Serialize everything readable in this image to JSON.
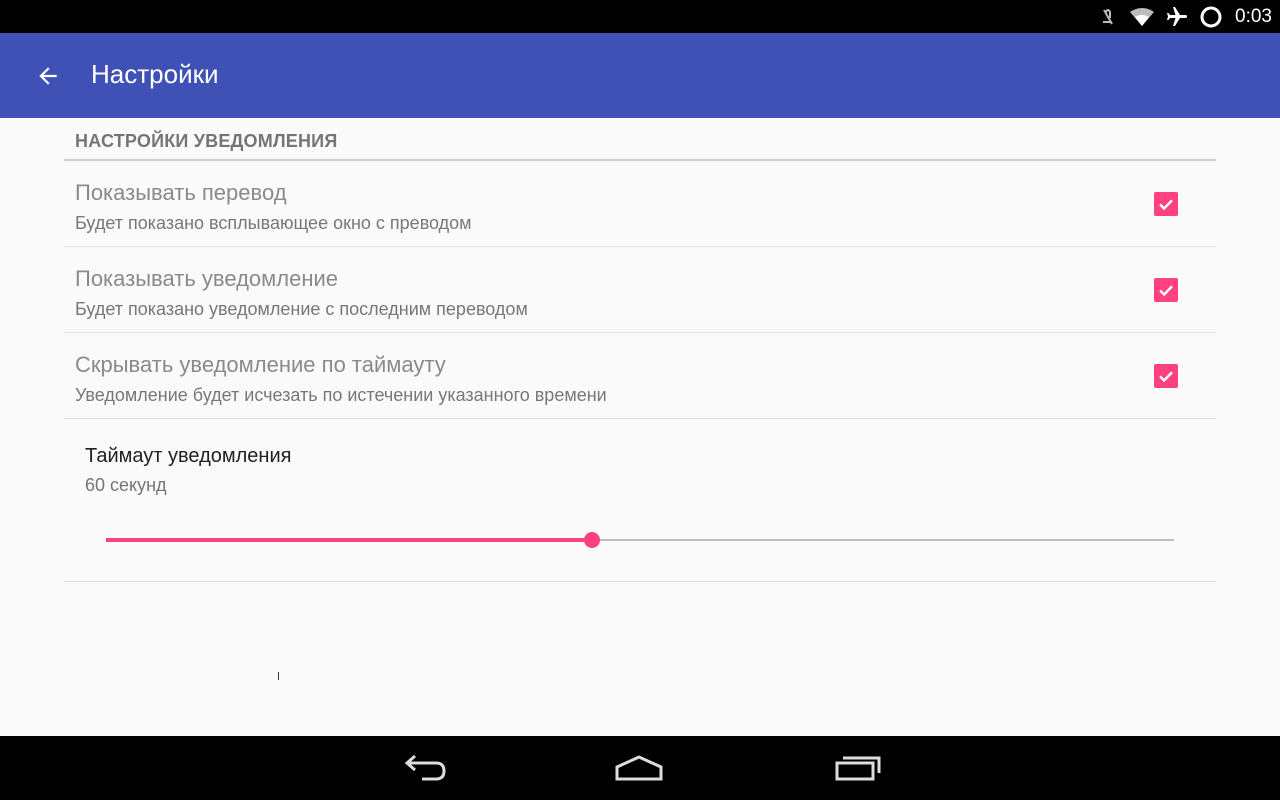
{
  "status_bar": {
    "time": "0:03",
    "icons": [
      "mute-icon",
      "wifi-icon",
      "airplane-mode-icon",
      "circle-status-icon"
    ]
  },
  "app_bar": {
    "title": "Настройки",
    "back_icon": "arrow-back-icon"
  },
  "category": {
    "label": "НАСТРОЙКИ УВЕДОМЛЕНИЯ"
  },
  "preferences": [
    {
      "title": "Показывать перевод",
      "summary": "Будет показано всплывающее окно с преводом",
      "checked": true
    },
    {
      "title": "Показывать уведомление",
      "summary": "Будет показано уведомление с последним переводом",
      "checked": true
    },
    {
      "title": "Скрывать уведомление по таймауту",
      "summary": "Уведомление будет исчезать по истечении указанного времени",
      "checked": true
    }
  ],
  "timeout": {
    "title": "Таймаут уведомления",
    "summary": "60 секунд",
    "slider_fraction": 0.455
  },
  "nav_bar": {
    "buttons": [
      "back-nav-icon",
      "home-nav-icon",
      "recents-nav-icon"
    ]
  },
  "colors": {
    "primary": "#3F51B5",
    "accent": "#FF4081",
    "background": "#FAFAFA"
  }
}
